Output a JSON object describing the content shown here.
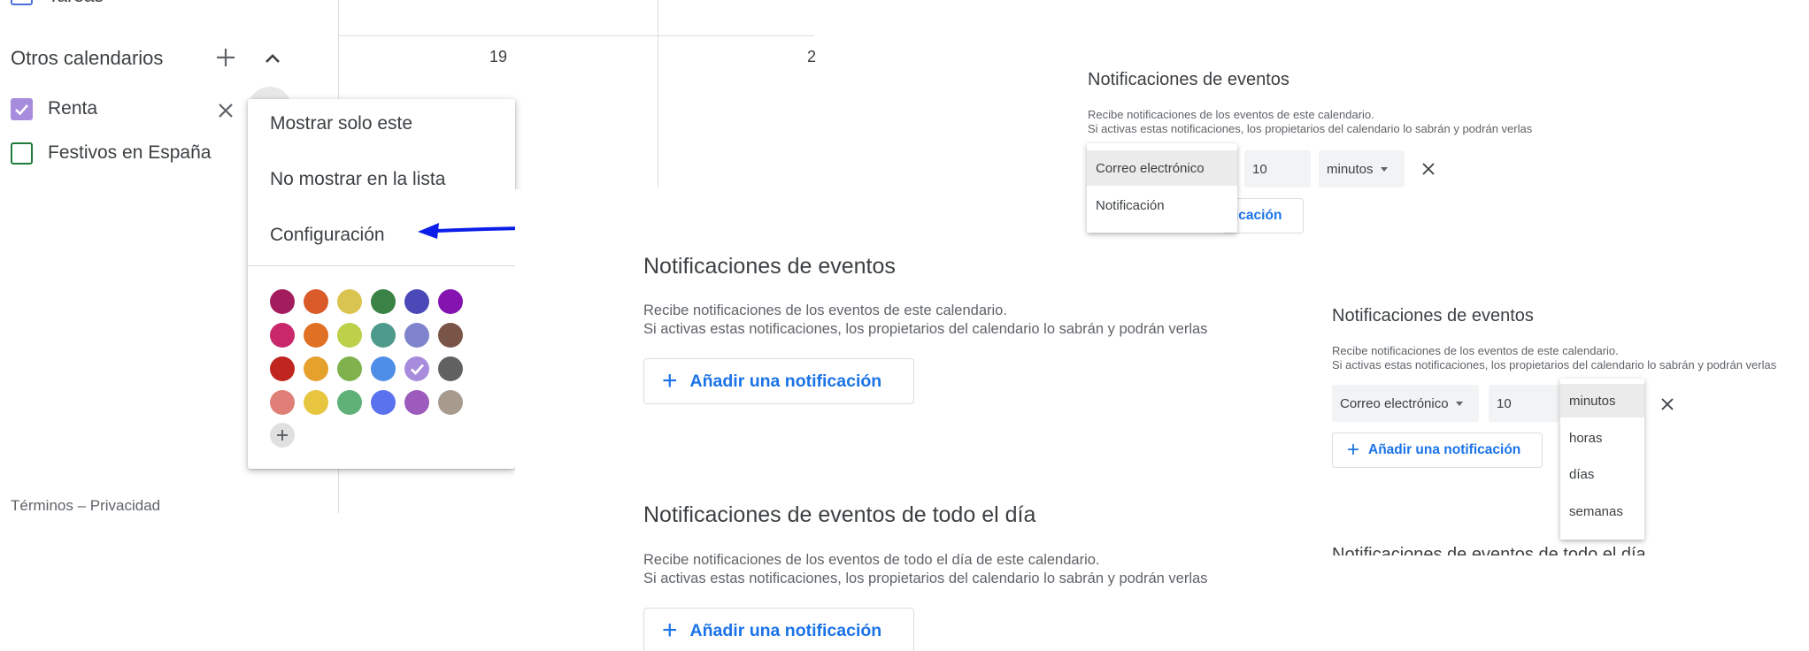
{
  "sidebar": {
    "tasks_label_partial": "Tareas",
    "other_calendars_title": "Otros calendarios",
    "calendars": [
      {
        "label": "Renta",
        "checked": true,
        "color": "#a78bdc"
      },
      {
        "label": "Festivos en España",
        "checked": false,
        "color": "#1e7c3c"
      }
    ],
    "footer": "Términos – Privacidad"
  },
  "calendar_grid": {
    "day_numbers": [
      "19",
      "2"
    ]
  },
  "context_menu": {
    "items": [
      "Mostrar solo este",
      "No mostrar en la lista",
      "Configuración"
    ],
    "palette": [
      [
        "#a31d5e",
        "#db5a2a",
        "#d9c44f",
        "#3a8245",
        "#4b49b8",
        "#8413b0"
      ],
      [
        "#c9286b",
        "#e07024",
        "#bdd049",
        "#4d9a8c",
        "#7f83cc",
        "#795548"
      ],
      [
        "#c0251f",
        "#e6a02c",
        "#7fb24d",
        "#4e8ee6",
        "#a78bdc",
        "#616161"
      ],
      [
        "#e07f78",
        "#e8c53e",
        "#5fb178",
        "#5b72ee",
        "#9c5bbd",
        "#a79b8e"
      ]
    ],
    "selected_color": "#a78bdc",
    "arrow_color": "#0b1de8"
  },
  "main_settings": {
    "event_notifications": {
      "title": "Notificaciones de eventos",
      "desc_line1": "Recibe notificaciones de los eventos de este calendario.",
      "desc_line2": "Si activas estas notificaciones, los propietarios del calendario lo sabrán y podrán verlas",
      "add_button": "Añadir una notificación"
    },
    "allday_notifications": {
      "title": "Notificaciones de eventos de todo el día",
      "desc_line1": "Recibe notificaciones de los eventos de todo el día de este calendario.",
      "desc_line2": "Si activas estas notificaciones, los propietarios del calendario lo sabrán y podrán verlas",
      "add_button": "Añadir una notificación"
    }
  },
  "top_right_panel": {
    "title": "Notificaciones de eventos",
    "desc_line1": "Recibe notificaciones de los eventos de este calendario.",
    "desc_line2": "Si activas estas notificaciones, los propietarios del calendario lo sabrán y podrán verlas",
    "type_options": [
      "Correo electrónico",
      "Notificación"
    ],
    "amount": "10",
    "unit": "minutos",
    "add_button_partial": "icación"
  },
  "bottom_right_panel": {
    "title": "Notificaciones de eventos",
    "desc_line1": "Recibe notificaciones de los eventos de este calendario.",
    "desc_line2": "Si activas estas notificaciones, los propietarios del calendario lo sabrán y podrán verlas",
    "type_value": "Correo electrónico",
    "amount": "10",
    "unit_options": [
      "minutos",
      "horas",
      "días",
      "semanas"
    ],
    "add_button": "Añadir una notificación",
    "next_section_partial": "Notificaciones de eventos de todo el día"
  },
  "colors": {
    "accent_blue": "#1a73e8",
    "text": "#3c4043",
    "muted": "#5f6368",
    "border": "#dadce0"
  }
}
